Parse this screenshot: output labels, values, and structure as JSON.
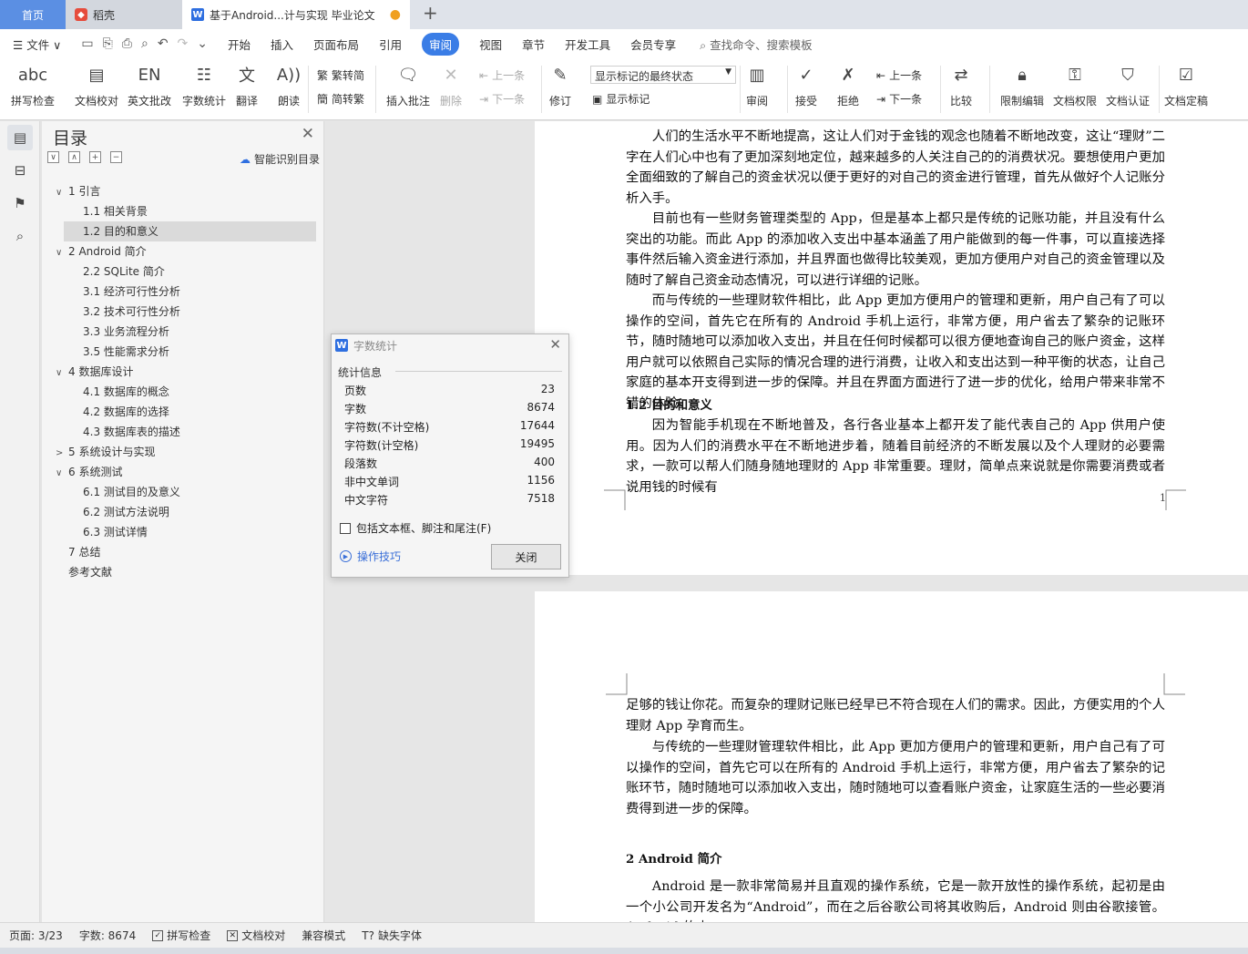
{
  "tabs": {
    "home": "首页",
    "shell": "稻壳",
    "doc": "基于Android...计与实现 毕业论文",
    "doc_modified_dot": "●",
    "add": "+"
  },
  "menu": {
    "file": "文件",
    "items": [
      "开始",
      "插入",
      "页面布局",
      "引用",
      "审阅",
      "视图",
      "章节",
      "开发工具",
      "会员专享"
    ],
    "active": "审阅",
    "search": "查找命令、搜索模板"
  },
  "ribbon": {
    "spell_check": "拼写检查",
    "doc_proof": "文档校对",
    "en_revise": "英文批改",
    "word_count": "字数统计",
    "translate": "翻译",
    "read_aloud": "朗读",
    "trad_conv": "繁转简",
    "simp_conv": "简转繁",
    "insert_comment": "插入批注",
    "delete": "删除",
    "prev_comment": "上一条",
    "next_comment": "下一条",
    "track": "修订",
    "markup_state": "显示标记的最终状态",
    "show_markup": "显示标记",
    "review": "审阅",
    "accept": "接受",
    "reject": "拒绝",
    "prev_change": "上一条",
    "next_change": "下一条",
    "compare": "比较",
    "restrict_edit": "限制编辑",
    "doc_rights": "文档权限",
    "doc_cert": "文档认证",
    "doc_finalize": "文档定稿"
  },
  "toc": {
    "title": "目录",
    "smart": "智能识别目录",
    "items": [
      {
        "label": "1 引言",
        "level": 1,
        "arrow": "∨"
      },
      {
        "label": "1.1 相关背景",
        "level": 2
      },
      {
        "label": "1.2 目的和意义",
        "level": 2,
        "selected": true
      },
      {
        "label": "2 Android 简介",
        "level": 1,
        "arrow": "∨"
      },
      {
        "label": "2.2 SQLite 简介",
        "level": 2
      },
      {
        "label": "3.1 经济可行性分析",
        "level": 2
      },
      {
        "label": "3.2 技术可行性分析",
        "level": 2
      },
      {
        "label": "3.3 业务流程分析",
        "level": 2
      },
      {
        "label": "3.5 性能需求分析",
        "level": 2
      },
      {
        "label": "4  数据库设计",
        "level": 1,
        "arrow": "∨"
      },
      {
        "label": "4.1  数据库的概念",
        "level": 2
      },
      {
        "label": "4.2  数据库的选择",
        "level": 2
      },
      {
        "label": "4.3  数据库表的描述",
        "level": 2
      },
      {
        "label": "5 系统设计与实现",
        "level": 1,
        "arrow": ">"
      },
      {
        "label": "6 系统测试",
        "level": 1,
        "arrow": "∨"
      },
      {
        "label": "6.1 测试目的及意义",
        "level": 2
      },
      {
        "label": "6.2 测试方法说明",
        "level": 2
      },
      {
        "label": "6.3 测试详情",
        "level": 2
      },
      {
        "label": "7 总结",
        "level": 1
      },
      {
        "label": "参考文献",
        "level": 1
      }
    ]
  },
  "dialog": {
    "title": "字数统计",
    "section": "统计信息",
    "stats": [
      {
        "label": "页数",
        "value": "23"
      },
      {
        "label": "字数",
        "value": "8674"
      },
      {
        "label": "字符数(不计空格)",
        "value": "17644"
      },
      {
        "label": "字符数(计空格)",
        "value": "19495"
      },
      {
        "label": "段落数",
        "value": "400"
      },
      {
        "label": "非中文单词",
        "value": "1156"
      },
      {
        "label": "中文字符",
        "value": "7518"
      }
    ],
    "include_label": "包括文本框、脚注和尾注(F)",
    "tips": "操作技巧",
    "close": "关闭"
  },
  "page1": {
    "p1": "人们的生活水平不断地提高，这让人们对于金钱的观念也随着不断地改变，这让“理财”二字在人们心中也有了更加深刻地定位，越来越多的人关注自己的的消费状况。要想使用户更加全面细致的了解自己的资金状况以便于更好的对自己的资金进行管理，首先从做好个人记账分析入手。",
    "p2": "目前也有一些财务管理类型的 App，但是基本上都只是传统的记账功能，并且没有什么突出的功能。而此 App 的添加收入支出中基本涵盖了用户能做到的每一件事，可以直接选择事件然后输入资金进行添加，并且界面也做得比较美观，更加方便用户对自己的资金管理以及随时了解自己资金动态情况，可以进行详细的记账。",
    "p3": "而与传统的一些理财软件相比，此 App 更加方便用户的管理和更新，用户自己有了可以操作的空间，首先它在所有的 Android 手机上运行，非常方便，用户省去了繁杂的记账环节，随时随地可以添加收入支出，并且在任何时候都可以很方便地查询自己的账户资金，这样用户就可以依照自己实际的情况合理的进行消费，让收入和支出达到一种平衡的状态，让自己家庭的基本开支得到进一步的保障。并且在界面方面进行了进一步的优化，给用户带来非常不错的体验。",
    "h": "1.2  目的和意义",
    "p4": "因为智能手机现在不断地普及，各行各业基本上都开发了能代表自己的 App 供用户使用。因为人们的消费水平在不断地进步着，随着目前经济的不断发展以及个人理财的必要需求，一款可以帮人们随身随地理财的 App 非常重要。理财，简单点来说就是你需要消费或者说用钱的时候有",
    "page_number": "1"
  },
  "page2": {
    "p1": "足够的钱让你花。而复杂的理财记账已经早已不符合现在人们的需求。因此，方便实用的个人理财 App 孕育而生。",
    "p2": "与传统的一些理财管理软件相比，此 App 更加方便用户的管理和更新，用户自己有了可以操作的空间，首先它可以在所有的 Android 手机上运行，非常方便，用户省去了繁杂的记账环节，随时随地可以添加收入支出，随时随地可以查看账户资金，让家庭生活的一些必要消费得到进一步的保障。",
    "h": "2 Android 简介",
    "p3": "Android 是一款非常简易并且直观的操作系统，它是一款开放性的操作系统，起初是由一个小公司开发名为“Android”，而在之后谷歌公司将其收购后，Android 则由谷歌接管。Android 的内"
  },
  "status": {
    "page": "页面: 3/23",
    "words": "字数: 8674",
    "spell": "拼写检查",
    "proof": "文档校对",
    "compat": "兼容模式",
    "missing_font": "缺失字体"
  }
}
